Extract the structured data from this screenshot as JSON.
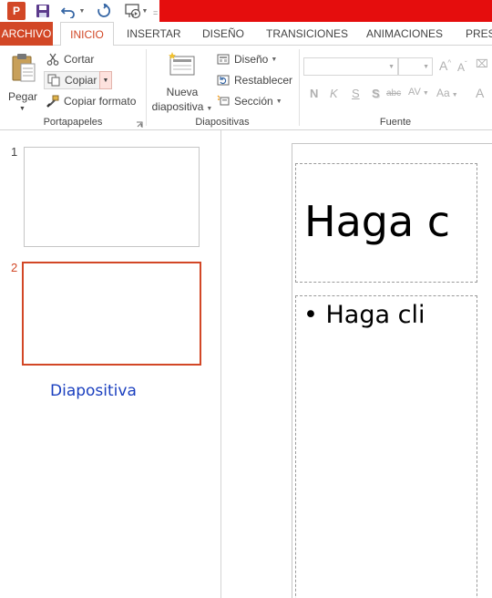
{
  "qat": {
    "app_logo": "P",
    "icons": [
      "powerpoint-logo",
      "save-icon",
      "undo-icon",
      "redo-icon",
      "start-presentation-icon"
    ],
    "accent_color": "#e50d0d"
  },
  "tabs": [
    {
      "label": "ARCHIVO"
    },
    {
      "label": "INICIO"
    },
    {
      "label": "INSERTAR"
    },
    {
      "label": "DISEÑO"
    },
    {
      "label": "TRANSICIONES"
    },
    {
      "label": "ANIMACIONES"
    },
    {
      "label": "PRESE"
    }
  ],
  "ribbon": {
    "clipboard": {
      "paste_label": "Pegar",
      "cut_label": "Cortar",
      "copy_label": "Copiar",
      "format_painter_label": "Copiar formato",
      "group_label": "Portapapeles"
    },
    "slides": {
      "new_slide_line1": "Nueva",
      "new_slide_line2": "diapositiva",
      "layout_label": "Diseño",
      "reset_label": "Restablecer",
      "section_label": "Sección",
      "group_label": "Diapositivas"
    },
    "font": {
      "font_name_value": "",
      "font_size_value": "",
      "bold_label": "N",
      "italic_label": "K",
      "underline_label": "S",
      "shadow_label": "S",
      "strikethrough_label": "abc",
      "spacing_label": "AV",
      "case_label": "Aa",
      "grow_label": "A",
      "shrink_label": "A",
      "color_label": "A",
      "group_label": "Fuente"
    }
  },
  "thumbnails": {
    "items": [
      {
        "number": "1"
      },
      {
        "number": "2"
      }
    ],
    "hover_label": "Diapositiva"
  },
  "slide": {
    "title_text": "Haga c",
    "body_text": "• Haga cli"
  },
  "colors": {
    "accent": "#d24726",
    "selected_border": "#d24726",
    "hover_label": "#1a3fbf"
  }
}
